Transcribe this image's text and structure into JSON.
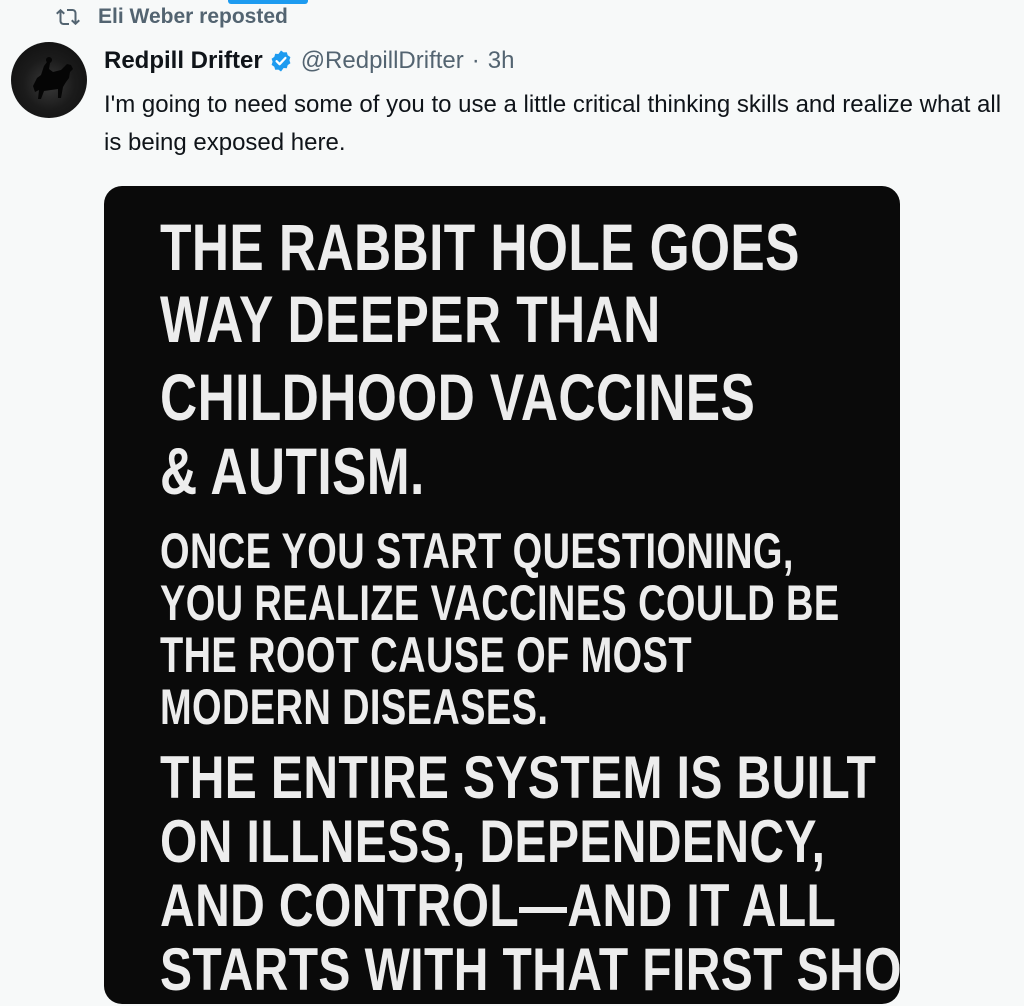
{
  "repost": {
    "label": "Eli Weber reposted"
  },
  "post": {
    "display_name": "Redpill Drifter",
    "handle": "@RedpillDrifter",
    "separator": "·",
    "timestamp": "3h",
    "text": "I'm going to need some of you to use a little critical thinking skills and realize what all is being exposed here.",
    "image_text": {
      "block1": [
        "THE RABBIT HOLE GOES",
        "WAY DEEPER THAN",
        "CHILDHOOD VACCINES",
        "& AUTISM."
      ],
      "block2": [
        "ONCE YOU START QUESTIONING,",
        "YOU REALIZE VACCINES COULD BE",
        "THE ROOT CAUSE OF MOST",
        "MODERN DISEASES."
      ],
      "block3": [
        "THE ENTIRE SYSTEM IS BUILT",
        "ON ILLNESS, DEPENDENCY,",
        "AND CONTROL—AND IT ALL",
        "STARTS WITH THAT FIRST SHOT."
      ]
    }
  },
  "icons": {
    "repost": "repost-icon",
    "verified": "verified-badge-icon",
    "avatar": "horse-rider-silhouette"
  },
  "colors": {
    "accent": "#1d9bf0",
    "secondary_text": "#536471",
    "primary_text": "#0f1419",
    "background": "#f7f9f9",
    "image_background": "#0a0a0a"
  }
}
